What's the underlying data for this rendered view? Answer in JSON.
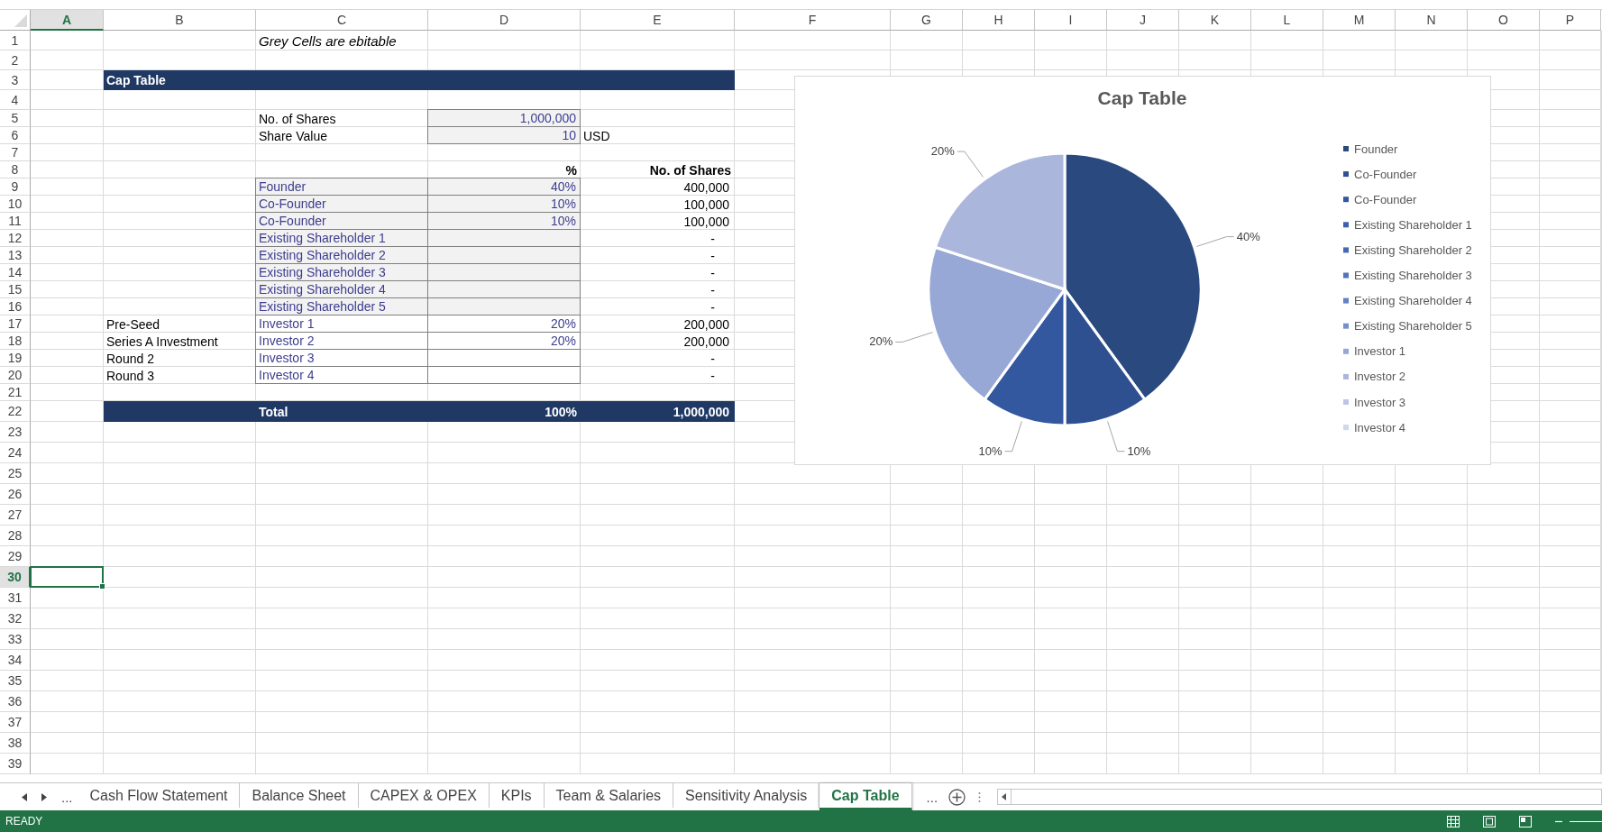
{
  "columns": [
    {
      "label": "A",
      "selected": true
    },
    {
      "label": "B",
      "selected": false
    },
    {
      "label": "C",
      "selected": false
    },
    {
      "label": "D",
      "selected": false
    },
    {
      "label": "E",
      "selected": false
    },
    {
      "label": "F",
      "selected": false
    },
    {
      "label": "G",
      "selected": false
    },
    {
      "label": "H",
      "selected": false
    },
    {
      "label": "I",
      "selected": false
    },
    {
      "label": "J",
      "selected": false
    },
    {
      "label": "K",
      "selected": false
    },
    {
      "label": "L",
      "selected": false
    },
    {
      "label": "M",
      "selected": false
    },
    {
      "label": "N",
      "selected": false
    },
    {
      "label": "O",
      "selected": false
    },
    {
      "label": "P",
      "selected": false
    }
  ],
  "row_numbers": [
    {
      "label": "1",
      "selected": false
    },
    {
      "label": "2",
      "selected": false
    },
    {
      "label": "3",
      "selected": false
    },
    {
      "label": "4",
      "selected": false
    },
    {
      "label": "5",
      "selected": false
    },
    {
      "label": "6",
      "selected": false
    },
    {
      "label": "7",
      "selected": false
    },
    {
      "label": "8",
      "selected": false
    },
    {
      "label": "9",
      "selected": false
    },
    {
      "label": "10",
      "selected": false
    },
    {
      "label": "11",
      "selected": false
    },
    {
      "label": "12",
      "selected": false
    },
    {
      "label": "13",
      "selected": false
    },
    {
      "label": "14",
      "selected": false
    },
    {
      "label": "15",
      "selected": false
    },
    {
      "label": "16",
      "selected": false
    },
    {
      "label": "17",
      "selected": false
    },
    {
      "label": "18",
      "selected": false
    },
    {
      "label": "19",
      "selected": false
    },
    {
      "label": "20",
      "selected": false
    },
    {
      "label": "21",
      "selected": false
    },
    {
      "label": "22",
      "selected": false
    },
    {
      "label": "23",
      "selected": false
    },
    {
      "label": "24",
      "selected": false
    },
    {
      "label": "25",
      "selected": false
    },
    {
      "label": "26",
      "selected": false
    },
    {
      "label": "27",
      "selected": false
    },
    {
      "label": "28",
      "selected": false
    },
    {
      "label": "29",
      "selected": false
    },
    {
      "label": "30",
      "selected": true
    },
    {
      "label": "31",
      "selected": false
    },
    {
      "label": "32",
      "selected": false
    },
    {
      "label": "33",
      "selected": false
    },
    {
      "label": "34",
      "selected": false
    },
    {
      "label": "35",
      "selected": false
    },
    {
      "label": "36",
      "selected": false
    },
    {
      "label": "37",
      "selected": false
    },
    {
      "label": "38",
      "selected": false
    },
    {
      "label": "39",
      "selected": false
    }
  ],
  "note": "Grey Cells are ebitable",
  "section_title": "Cap Table",
  "inputs": [
    {
      "label": "No. of Shares",
      "value": "1,000,000"
    },
    {
      "label": "Share Value",
      "value": "10",
      "unit": "USD"
    }
  ],
  "table": {
    "percent_header": "%",
    "shares_header": "No. of Shares",
    "rows": [
      {
        "name": "Founder",
        "percent": "40%",
        "shares": "400,000",
        "shaded": true
      },
      {
        "name": "Co-Founder",
        "percent": "10%",
        "shares": "100,000",
        "shaded": true
      },
      {
        "name": "Co-Founder",
        "percent": "10%",
        "shares": "100,000",
        "shaded": true
      },
      {
        "name": "Existing Shareholder 1",
        "shares": "-",
        "shaded": true
      },
      {
        "name": "Existing Shareholder 2",
        "shares": "-",
        "shaded": true
      },
      {
        "name": "Existing Shareholder 3",
        "shares": "-",
        "shaded": true
      },
      {
        "name": "Existing Shareholder 4",
        "shares": "-",
        "shaded": true
      },
      {
        "name": "Existing Shareholder 5",
        "shares": "-",
        "shaded": true
      },
      {
        "round": "Pre-Seed",
        "name": "Investor 1",
        "percent": "20%",
        "shares": "200,000",
        "shaded": false
      },
      {
        "round": "Series A Investment",
        "name": "Investor 2",
        "percent": "20%",
        "shares": "200,000",
        "shaded": false
      },
      {
        "round": "Round 2",
        "name": "Investor 3",
        "shares": "-",
        "shaded": false
      },
      {
        "round": "Round 3",
        "name": "Investor 4",
        "shares": "-",
        "shaded": false
      }
    ],
    "total": {
      "label": "Total",
      "percent": "100%",
      "shares": "1,000,000"
    }
  },
  "chart": {
    "chart_data": {
      "type": "pie",
      "title": "Cap Table",
      "categories": [
        "Founder",
        "Co-Founder",
        "Co-Founder",
        "Existing Shareholder 1",
        "Existing Shareholder 2",
        "Existing Shareholder 3",
        "Existing Shareholder 4",
        "Existing Shareholder 5",
        "Investor 1",
        "Investor 2",
        "Investor 3",
        "Investor 4"
      ],
      "values": [
        40,
        10,
        10,
        0,
        0,
        0,
        0,
        0,
        20,
        20,
        0,
        0
      ],
      "colors": [
        "#2a4a7f",
        "#2e5090",
        "#34589f",
        "#3b61ad",
        "#4468b4",
        "#5274bb",
        "#6282c2",
        "#7590c9",
        "#97a8d6",
        "#abb6dc",
        "#bcc5e3",
        "#d0d7eb"
      ],
      "value_labels": [
        "40%",
        "10%",
        "10%",
        null,
        null,
        null,
        null,
        null,
        "20%",
        "20%",
        null,
        null
      ],
      "legend": true
    }
  },
  "sheet_tabs": {
    "overflow_left": "...",
    "overflow_right": "...",
    "tabs": [
      {
        "label": "Cash Flow Statement",
        "selected": false
      },
      {
        "label": "Balance Sheet",
        "selected": false
      },
      {
        "label": "CAPEX & OPEX",
        "selected": false
      },
      {
        "label": "KPIs",
        "selected": false
      },
      {
        "label": "Team & Salaries",
        "selected": false
      },
      {
        "label": "Sensitivity Analysis",
        "selected": false
      },
      {
        "label": "Cap Table",
        "selected": true
      }
    ]
  },
  "status_bar": {
    "text": "READY"
  }
}
